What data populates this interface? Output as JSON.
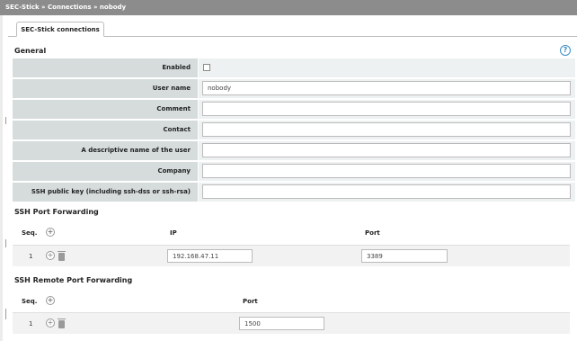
{
  "breadcrumb": "SEC-Stick » Connections » nobody",
  "tab": {
    "label": "SEC-Stick connections"
  },
  "general": {
    "title": "General",
    "help": "?",
    "fields": [
      {
        "label": "Enabled",
        "type": "checkbox",
        "checked": false
      },
      {
        "label": "User name",
        "type": "text",
        "value": "nobody"
      },
      {
        "label": "Comment",
        "type": "text",
        "value": ""
      },
      {
        "label": "Contact",
        "type": "text",
        "value": ""
      },
      {
        "label": "A descriptive name of the user",
        "type": "text",
        "value": ""
      },
      {
        "label": "Company",
        "type": "text",
        "value": ""
      },
      {
        "label": "SSH public key (including ssh-dss or ssh-rsa)",
        "type": "text",
        "value": ""
      }
    ]
  },
  "ssh_port_forwarding": {
    "title": "SSH Port Forwarding",
    "headers": {
      "seq": "Seq.",
      "ip": "IP",
      "port": "Port"
    },
    "rows": [
      {
        "seq": "1",
        "ip": "192.168.47.11",
        "port": "3389"
      }
    ]
  },
  "ssh_remote_port_forwarding": {
    "title": "SSH Remote Port Forwarding",
    "headers": {
      "seq": "Seq.",
      "port": "Port"
    },
    "rows": [
      {
        "seq": "1",
        "port": "1500"
      }
    ]
  },
  "icons": {
    "add": "plus-circle-icon",
    "delete": "trash-icon",
    "help": "question-circle-icon"
  },
  "colors": {
    "topbar": "#8c8c8c",
    "label_bg": "#d6dcdc",
    "help": "#3c8fc7"
  }
}
